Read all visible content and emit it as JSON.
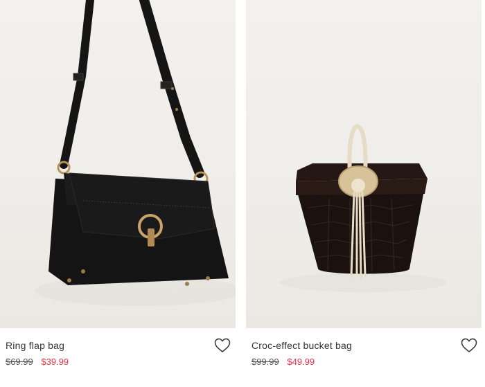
{
  "products": [
    {
      "name": "Ring flap bag",
      "old_price": "$69.99",
      "new_price": "$39.99",
      "wishlist_icon": "heart-outline-icon",
      "image": "black-leather-crossbody-bag"
    },
    {
      "name": "Croc-effect bucket bag",
      "old_price": "$99.99",
      "new_price": "$49.99",
      "wishlist_icon": "heart-outline-icon",
      "image": "croc-bucket-bag"
    }
  ],
  "colors": {
    "sale_price": "#e0364a",
    "old_price": "#555555",
    "product_name": "#333333"
  }
}
